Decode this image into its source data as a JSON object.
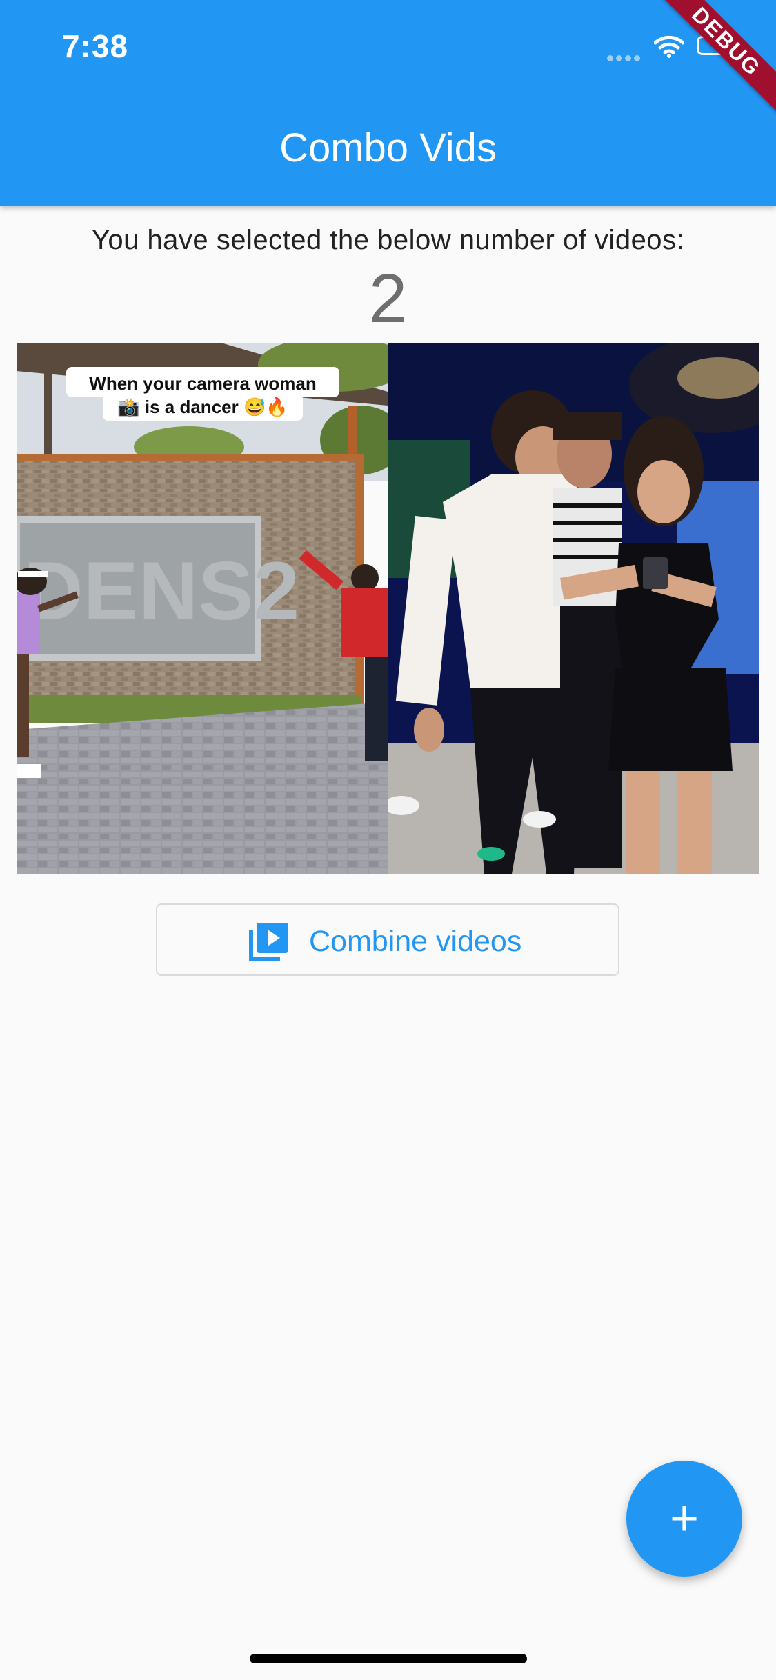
{
  "status_bar": {
    "time": "7:38",
    "icons": [
      "cellular-signal-icon",
      "wifi-icon",
      "battery-icon"
    ]
  },
  "debug_banner": {
    "label": "DEBUG"
  },
  "app_bar": {
    "title": "Combo Vids",
    "color": "#2196f3"
  },
  "main": {
    "selected_label": "You have selected the below number of videos:",
    "selected_count": "2",
    "thumbnails": [
      {
        "caption_line1": "When your camera woman",
        "caption_line2": "📸 is a dancer 😅🔥",
        "sign_text": "DENS2"
      },
      {
        "caption_line1": "",
        "caption_line2": "",
        "sign_text": ""
      }
    ],
    "combine_button": {
      "label": "Combine videos",
      "icon": "video-library-icon"
    }
  },
  "fab": {
    "label": "+",
    "icon": "add-icon"
  }
}
